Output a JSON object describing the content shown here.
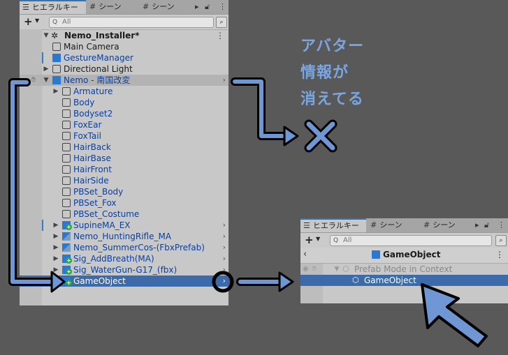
{
  "left_panel": {
    "tabs": [
      {
        "icon": "list-icon",
        "label": "ヒエラルキー"
      },
      {
        "icon": "grid-icon",
        "label": "シーン"
      },
      {
        "icon": "grid-icon",
        "label": "シーン"
      }
    ],
    "search_placeholder": "All",
    "scene_name": "Nemo_Installer*",
    "rows": [
      {
        "label": "Main Camera",
        "color": "#1a1a1a"
      },
      {
        "label": "GestureManager",
        "color": "#0d3f9a"
      },
      {
        "label": "Directional Light",
        "color": "#1a1a1a"
      },
      {
        "label": "Nemo - 南国改変",
        "color": "#0d3f9a"
      },
      {
        "label": "Armature",
        "color": "#0d3f9a"
      },
      {
        "label": "Body",
        "color": "#0d3f9a"
      },
      {
        "label": "Bodyset2",
        "color": "#0d3f9a"
      },
      {
        "label": "FoxEar",
        "color": "#0d3f9a"
      },
      {
        "label": "FoxTail",
        "color": "#0d3f9a"
      },
      {
        "label": "HairBack",
        "color": "#0d3f9a"
      },
      {
        "label": "HairBase",
        "color": "#0d3f9a"
      },
      {
        "label": "HairFront",
        "color": "#0d3f9a"
      },
      {
        "label": "HairSide",
        "color": "#0d3f9a"
      },
      {
        "label": "PBSet_Body",
        "color": "#0d3f9a"
      },
      {
        "label": "PBSet_Fox",
        "color": "#0d3f9a"
      },
      {
        "label": "PBSet_Costume",
        "color": "#0d3f9a"
      },
      {
        "label": "SupineMA_EX",
        "color": "#0d3f9a"
      },
      {
        "label": "Nemo_HuntingRifle_MA",
        "color": "#0d3f9a"
      },
      {
        "label": "Nemo_SummerCos-(FbxPrefab)",
        "color": "#0d3f9a"
      },
      {
        "label": "Sig_AddBreath(MA)",
        "color": "#0d3f9a"
      },
      {
        "label": "Sig_WaterGun-G17_(fbx)",
        "color": "#0d3f9a"
      },
      {
        "label": "GameObject",
        "color": "#ffffff"
      }
    ]
  },
  "right_panel": {
    "tabs": [
      {
        "icon": "list-icon",
        "label": "ヒエラルキー"
      },
      {
        "icon": "grid-icon",
        "label": "シーン"
      },
      {
        "icon": "grid-icon",
        "label": "シーン"
      }
    ],
    "search_placeholder": "All",
    "header_title": "GameObject",
    "context_row": "Prefab Mode in Context",
    "selected_row": "GameObject"
  },
  "annotation": {
    "lines": [
      "アバター",
      "情報が",
      "消えてる"
    ],
    "color": "#7aa6e0"
  },
  "colors": {
    "selection": "#3d6aa8",
    "prefab_blue": "#0d3f9a",
    "arrow_fill": "#6f97d4"
  }
}
